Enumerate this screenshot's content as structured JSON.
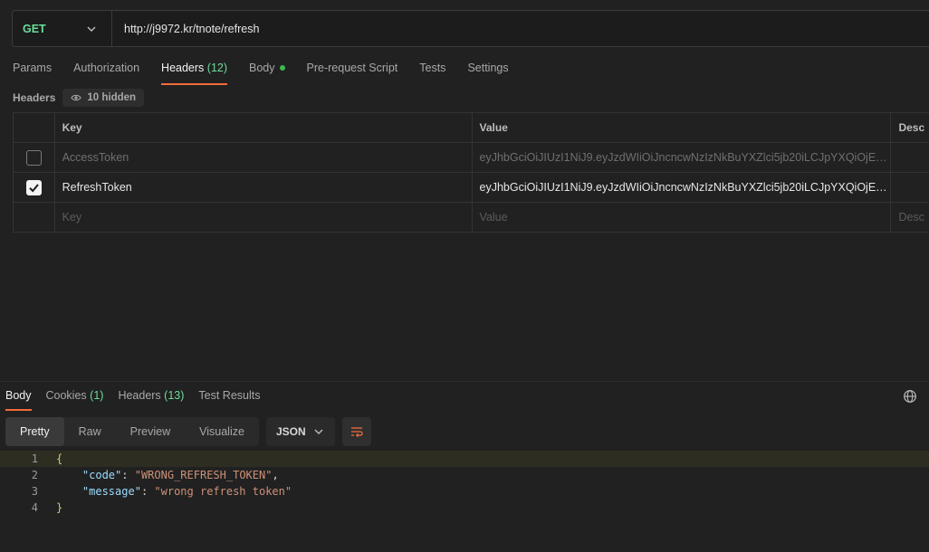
{
  "request": {
    "method": "GET",
    "url": "http://j9972.kr/tnote/refresh"
  },
  "request_tabs": [
    {
      "label": "Params"
    },
    {
      "label": "Authorization"
    },
    {
      "label": "Headers",
      "count": "(12)"
    },
    {
      "label": "Body"
    },
    {
      "label": "Pre-request Script"
    },
    {
      "label": "Tests"
    },
    {
      "label": "Settings"
    }
  ],
  "headers_section": {
    "label": "Headers",
    "hidden_label": "10 hidden"
  },
  "table": {
    "columns": [
      "Key",
      "Value",
      "Desc"
    ],
    "rows": [
      {
        "key": "AccessToken",
        "value": "eyJhbGciOiJIUzI1NiJ9.eyJzdWIiOiJncncwNzIzNkBuYXZlci5jb20iLCJpYXQiOjE3...",
        "checked": false
      },
      {
        "key": "RefreshToken",
        "value": "eyJhbGciOiJIUzI1NiJ9.eyJzdWIiOiJncncwNzIzNkBuYXZlci5jb20iLCJpYXQiOjE3...",
        "checked": true
      }
    ],
    "placeholder": {
      "key": "Key",
      "value": "Value",
      "desc": "Desc"
    }
  },
  "response_tabs": [
    {
      "label": "Body"
    },
    {
      "label": "Cookies",
      "count": "(1)"
    },
    {
      "label": "Headers",
      "count": "(13)"
    },
    {
      "label": "Test Results"
    }
  ],
  "view_modes": [
    "Pretty",
    "Raw",
    "Preview",
    "Visualize"
  ],
  "format": "JSON",
  "code": {
    "line_numbers": [
      "1",
      "2",
      "3",
      "4"
    ],
    "open_brace": "{",
    "close_brace": "}",
    "fields": [
      {
        "key": "\"code\"",
        "value": "\"WRONG_REFRESH_TOKEN\"",
        "trail": ","
      },
      {
        "key": "\"message\"",
        "value": "\"wrong refresh token\"",
        "trail": ""
      }
    ]
  },
  "colors": {
    "accent": "#f26b3a",
    "method": "#6bdd9a",
    "background": "#212121"
  }
}
